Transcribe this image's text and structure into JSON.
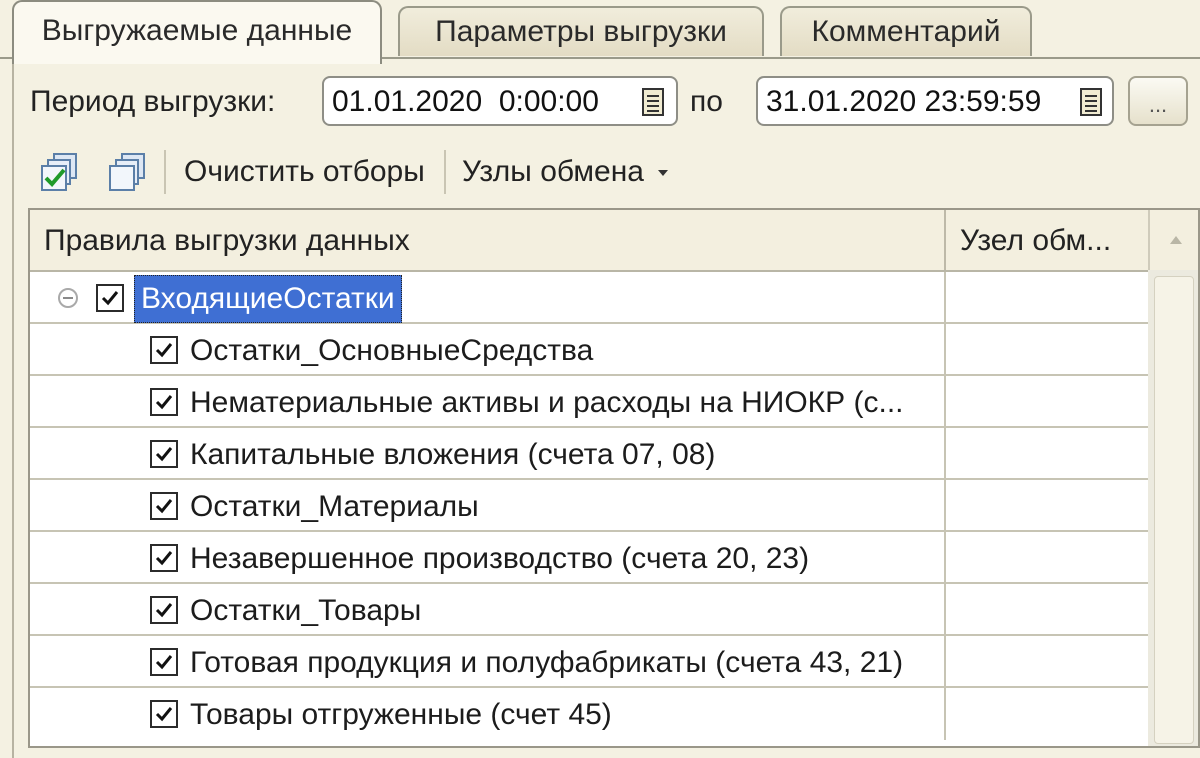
{
  "tabs": [
    {
      "label": "Выгружаемые данные",
      "active": true
    },
    {
      "label": "Параметры выгрузки",
      "active": false
    },
    {
      "label": "Комментарий",
      "active": false
    }
  ],
  "period": {
    "label": "Период выгрузки:",
    "from": "01.01.2020  0:00:00",
    "to_label": "по",
    "to": "31.01.2020 23:59:59",
    "choose_button": "..."
  },
  "toolbar": {
    "clear_filters": "Очистить отборы",
    "exchange_nodes": "Узлы обмена"
  },
  "table": {
    "columns": [
      "Правила выгрузки данных",
      "Узел обм..."
    ],
    "root": {
      "label": "ВходящиеОстатки",
      "checked": true
    },
    "rows": [
      {
        "label": "Остатки_ОсновныеСредства",
        "checked": true
      },
      {
        "label": "Нематериальные активы и расходы на НИОКР (с...",
        "checked": true
      },
      {
        "label": "Капитальные вложения (счета 07, 08)",
        "checked": true
      },
      {
        "label": "Остатки_Материалы",
        "checked": true
      },
      {
        "label": "Незавершенное производство (счета 20, 23)",
        "checked": true
      },
      {
        "label": "Остатки_Товары",
        "checked": true
      },
      {
        "label": "Готовая продукция и полуфабрикаты (счета 43, 21)",
        "checked": true
      },
      {
        "label": "Товары отгруженные (счет 45)",
        "checked": true
      }
    ]
  },
  "colors": {
    "selection": "#3f6fd3",
    "background": "#f4f1e2"
  }
}
